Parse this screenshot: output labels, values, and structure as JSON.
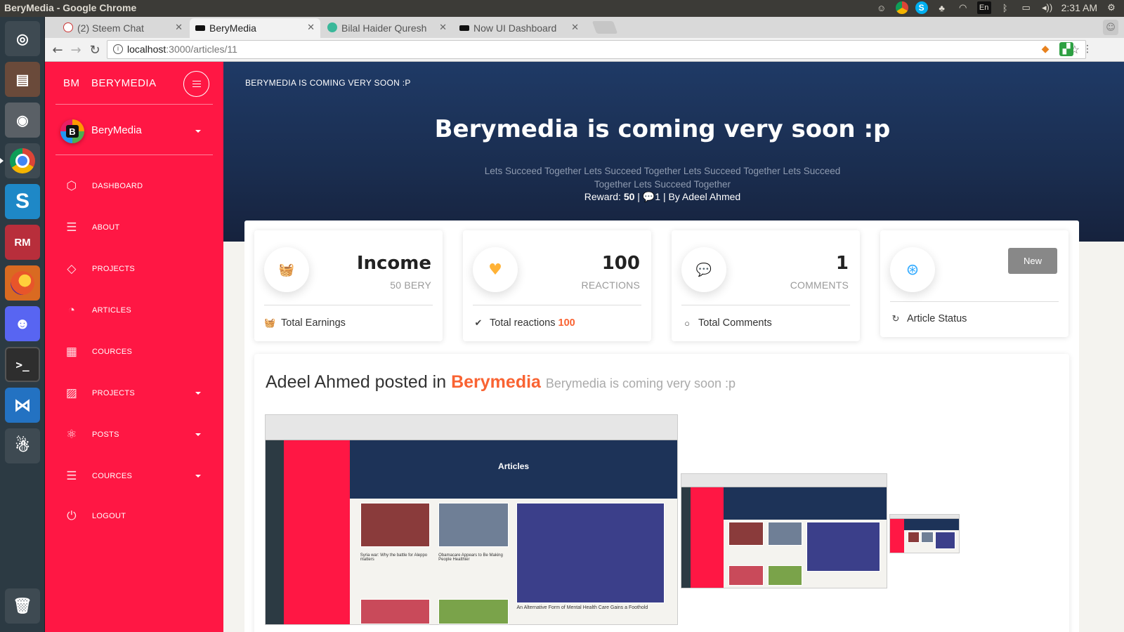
{
  "os": {
    "window_title": "BeryMedia - Google Chrome",
    "lang": "En",
    "volume": "◂))",
    "time": "2:31 AM"
  },
  "launcher": [
    "ubuntu-icon",
    "files-icon",
    "camera-icon",
    "chrome-icon",
    "skype-icon",
    "rubymine-icon",
    "firefox-icon",
    "discord-icon",
    "terminal-icon",
    "vscode-icon",
    "bot-icon",
    "trash-icon"
  ],
  "browser": {
    "tabs": [
      {
        "label": "(2) Steem Chat",
        "active": false
      },
      {
        "label": "BeryMedia",
        "active": true
      },
      {
        "label": "Bilal Haider Quresh",
        "active": false
      },
      {
        "label": "Now UI Dashboard",
        "active": false
      }
    ],
    "url_host": "localhost",
    "url_path": ":3000/articles/11"
  },
  "sidebar": {
    "logo_mini": "BM",
    "logo_normal": "BERYMEDIA",
    "user_name": "BeryMedia",
    "user_avatar_letter": "B",
    "items": [
      {
        "label": "DASHBOARD",
        "icon": "cube-icon"
      },
      {
        "label": "ABOUT",
        "icon": "list-icon"
      },
      {
        "label": "PROJECTS",
        "icon": "diamond-icon"
      },
      {
        "label": "ARTICLES",
        "icon": "pie-chart-icon"
      },
      {
        "label": "COURCES",
        "icon": "calendar-icon"
      },
      {
        "label": "PROJECTS",
        "icon": "image-icon"
      },
      {
        "label": "POSTS",
        "icon": "atom-icon"
      },
      {
        "label": "COURCES",
        "icon": "list-icon"
      },
      {
        "label": "LOGOUT",
        "icon": "power-icon"
      }
    ]
  },
  "hero": {
    "brand": "BERYMEDIA IS COMING VERY SOON :P",
    "title": "Berymedia is coming very soon :p",
    "description": "Lets Succeed Together Lets Succeed Together Lets Succeed Together Lets Succeed Together Lets Succeed Together",
    "reward_label": "Reward:",
    "reward_value": "50",
    "comments_count": "1",
    "by_text": "By Adeel Ahmed"
  },
  "stats": [
    {
      "title": "Income",
      "subtitle": "50 BERY",
      "footer": "Total Earnings",
      "icon": "basket-icon",
      "icon_color": "#ff3636"
    },
    {
      "title": "100",
      "subtitle": "REACTIONS",
      "footer": "Total reactions",
      "footer_value": "100",
      "icon": "heart-icon",
      "icon_color": "#ffb236"
    },
    {
      "title": "1",
      "subtitle": "COMMENTS",
      "footer": "Total Comments",
      "icon": "chat-icon",
      "icon_color": "#e8202b"
    },
    {
      "title": "",
      "subtitle": "",
      "footer": "Article Status",
      "button": "New",
      "icon": "lifebuoy-icon",
      "icon_color": "#2ca8ff"
    }
  ],
  "post": {
    "author": "Adeel Ahmed",
    "posted_in": "posted in",
    "category": "Berymedia",
    "subtitle": "Berymedia is coming very soon :p",
    "screenshot_title": "Articles",
    "screenshot_caption_1": "Syria war: Why the battle for Aleppo matters",
    "screenshot_caption_2": "Obamacare Appears to Be Making People Healthier",
    "screenshot_caption_3": "An Alternative Form of Mental Health Care Gains a Foothold"
  },
  "colors": {
    "sidebar": "#ff1744",
    "hero": "#1a2d4f",
    "accent": "#f96332"
  }
}
